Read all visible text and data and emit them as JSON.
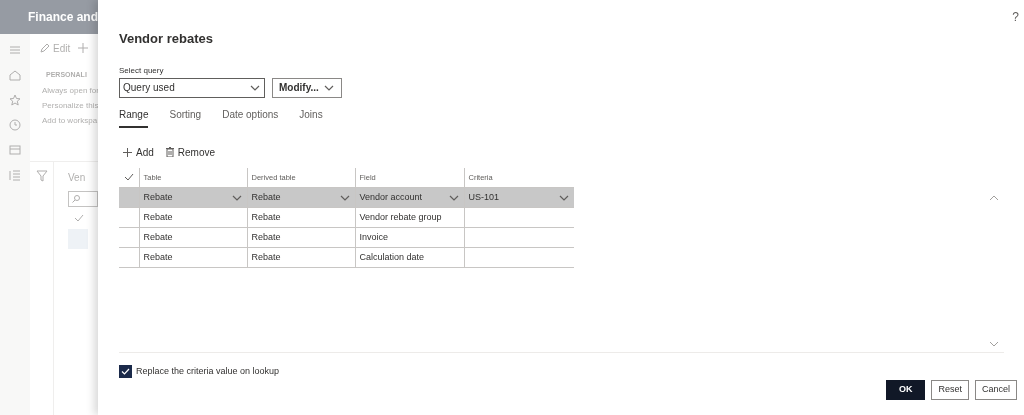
{
  "background": {
    "app_title": "Finance and",
    "toolbar": [
      {
        "kind": "edit",
        "label": "Edit"
      },
      {
        "kind": "new"
      }
    ],
    "personalize": {
      "heading": "PERSONALI",
      "links": [
        "Always open for",
        "Personalize this",
        "Add to workspa"
      ]
    },
    "list_title": "Ven"
  },
  "dialog": {
    "help": "?",
    "title": "Vendor rebates",
    "select_query": {
      "label": "Select query",
      "value": "Query used"
    },
    "modify_button": "Modify...",
    "tabs": [
      {
        "label": "Range",
        "selected": true
      },
      {
        "label": "Sorting",
        "selected": false
      },
      {
        "label": "Date options",
        "selected": false
      },
      {
        "label": "Joins",
        "selected": false
      }
    ],
    "actions": [
      {
        "kind": "add",
        "label": "Add"
      },
      {
        "kind": "remove",
        "label": "Remove"
      }
    ],
    "table": {
      "columns": [
        "Table",
        "Derived table",
        "Field",
        "Criteria"
      ],
      "rows": [
        {
          "selected": true,
          "table": "Rebate",
          "derived_table": "Rebate",
          "field": "Vendor account",
          "criteria": "US-101"
        },
        {
          "selected": false,
          "table": "Rebate",
          "derived_table": "Rebate",
          "field": "Vendor rebate group"
        },
        {
          "selected": false,
          "table": "Rebate",
          "derived_table": "Rebate",
          "field": "Invoice"
        },
        {
          "selected": false,
          "table": "Rebate",
          "derived_table": "Rebate",
          "field": "Calculation date"
        }
      ]
    },
    "replace_lookup": {
      "label": "Replace the criteria value on lookup",
      "checked": true
    },
    "buttons": [
      {
        "label": "OK",
        "primary": true
      },
      {
        "label": "Reset",
        "primary": false
      },
      {
        "label": "Cancel",
        "primary": false
      }
    ]
  }
}
